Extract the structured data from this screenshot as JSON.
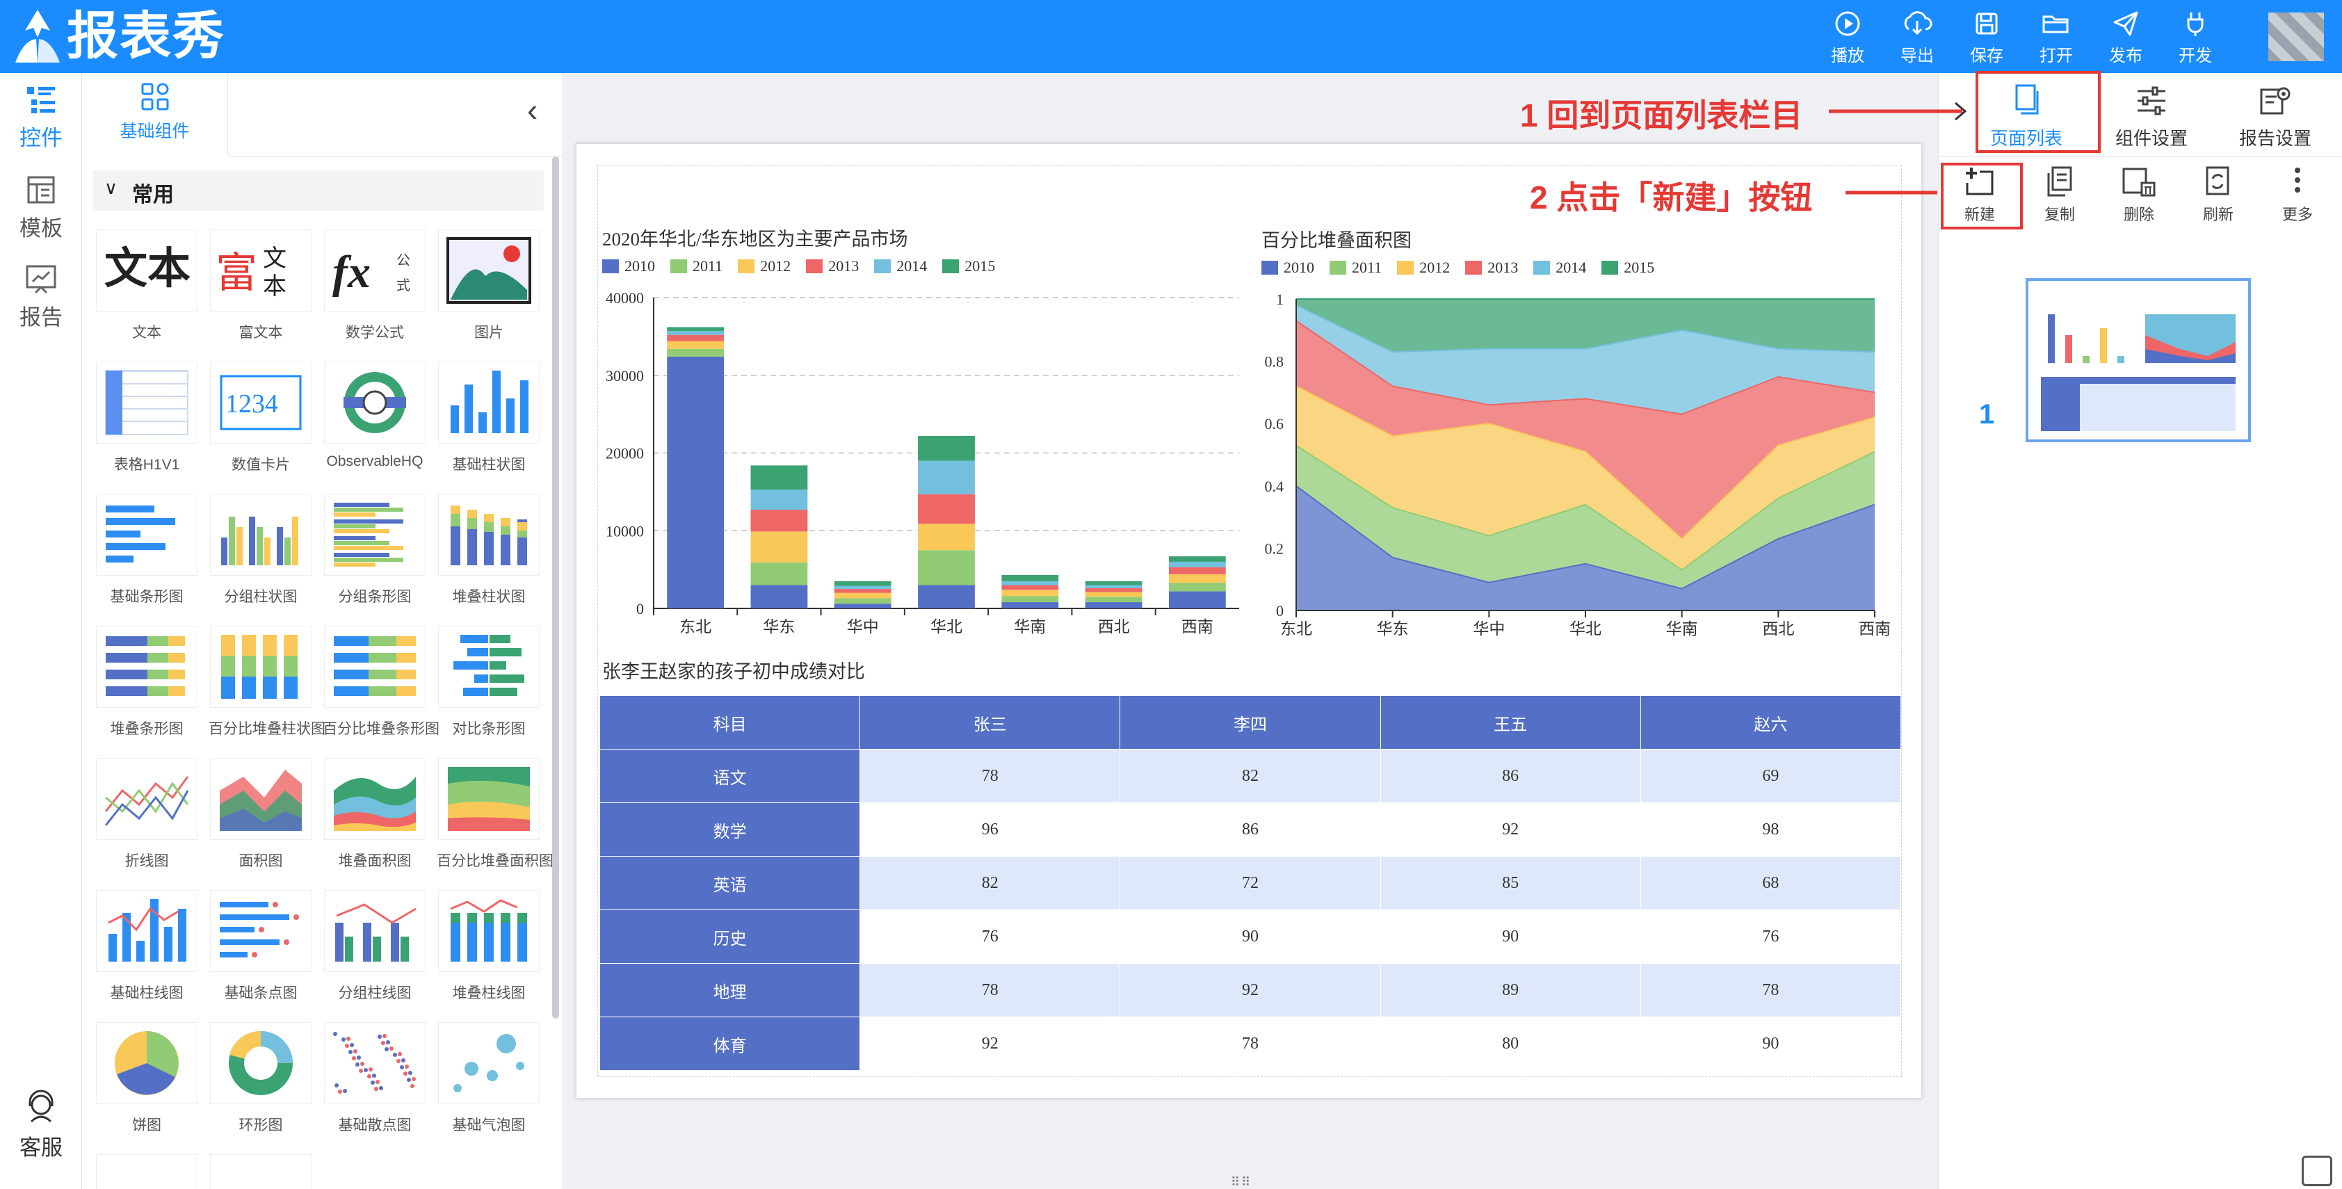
{
  "app": {
    "title": "报表秀"
  },
  "toolbar": {
    "items": [
      {
        "label": "播放",
        "icon": "play-icon"
      },
      {
        "label": "导出",
        "icon": "download-icon"
      },
      {
        "label": "保存",
        "icon": "save-icon"
      },
      {
        "label": "打开",
        "icon": "folder-icon"
      },
      {
        "label": "发布",
        "icon": "send-icon"
      },
      {
        "label": "开发",
        "icon": "plug-icon"
      }
    ]
  },
  "leftnav": {
    "items": [
      {
        "label": "控件",
        "icon": "widgets-icon",
        "active": true
      },
      {
        "label": "模板",
        "icon": "template-icon"
      },
      {
        "label": "报告",
        "icon": "report-icon"
      }
    ],
    "support": "客服"
  },
  "panel": {
    "tab": "基础组件",
    "section": "常用",
    "widgets": [
      {
        "label": "文本",
        "icon": "text-widget-icon"
      },
      {
        "label": "富文本",
        "icon": "rich-text-icon"
      },
      {
        "label": "数学公式",
        "icon": "formula-icon"
      },
      {
        "label": "图片",
        "icon": "image-icon"
      },
      {
        "label": "表格H1V1",
        "icon": "table-icon"
      },
      {
        "label": "数值卡片",
        "icon": "number-card-icon"
      },
      {
        "label": "ObservableHQ",
        "icon": "observable-icon"
      },
      {
        "label": "基础柱状图",
        "icon": "bar-chart-icon"
      },
      {
        "label": "基础条形图",
        "icon": "hbar-chart-icon"
      },
      {
        "label": "分组柱状图",
        "icon": "grouped-bar-icon"
      },
      {
        "label": "分组条形图",
        "icon": "grouped-hbar-icon"
      },
      {
        "label": "堆叠柱状图",
        "icon": "stacked-bar-icon"
      },
      {
        "label": "堆叠条形图",
        "icon": "stacked-hbar-icon"
      },
      {
        "label": "百分比堆叠柱状图",
        "icon": "percent-stacked-bar-icon"
      },
      {
        "label": "百分比堆叠条形图",
        "icon": "percent-stacked-hbar-icon"
      },
      {
        "label": "对比条形图",
        "icon": "compare-hbar-icon"
      },
      {
        "label": "折线图",
        "icon": "line-chart-icon"
      },
      {
        "label": "面积图",
        "icon": "area-chart-icon"
      },
      {
        "label": "堆叠面积图",
        "icon": "stacked-area-icon"
      },
      {
        "label": "百分比堆叠面积图",
        "icon": "percent-area-icon"
      },
      {
        "label": "基础柱线图",
        "icon": "bar-line-icon"
      },
      {
        "label": "基础条点图",
        "icon": "bar-dot-icon"
      },
      {
        "label": "分组柱线图",
        "icon": "grouped-bar-line-icon"
      },
      {
        "label": "堆叠柱线图",
        "icon": "stacked-bar-line-icon"
      },
      {
        "label": "饼图",
        "icon": "pie-icon"
      },
      {
        "label": "环形图",
        "icon": "donut-icon"
      },
      {
        "label": "基础散点图",
        "icon": "scatter-icon"
      },
      {
        "label": "基础气泡图",
        "icon": "bubble-icon"
      }
    ]
  },
  "rightpanel": {
    "tabs": [
      {
        "label": "页面列表",
        "icon": "pages-icon",
        "active": true
      },
      {
        "label": "组件设置",
        "icon": "sliders-icon"
      },
      {
        "label": "报告设置",
        "icon": "report-settings-icon"
      }
    ],
    "tools": [
      {
        "label": "新建",
        "icon": "new-page-icon"
      },
      {
        "label": "复制",
        "icon": "copy-icon"
      },
      {
        "label": "删除",
        "icon": "delete-icon"
      },
      {
        "label": "刷新",
        "icon": "refresh-icon"
      },
      {
        "label": "更多",
        "icon": "more-icon"
      }
    ],
    "page_number": "1"
  },
  "callouts": {
    "one": "1 回到页面列表栏目",
    "two": "2 点击「新建」按钮"
  },
  "colors": {
    "brand": "#1a8cff",
    "series": [
      "#5470c6",
      "#91cc75",
      "#fac858",
      "#ee6666",
      "#73c0de",
      "#3ba272"
    ],
    "highlight": "#e53935"
  },
  "chart_data": [
    {
      "type": "bar",
      "stacked": true,
      "title": "2020年华北/华东地区为主要产品市场",
      "categories": [
        "东北",
        "华东",
        "华中",
        "华北",
        "华南",
        "西北",
        "西南"
      ],
      "yticks": [
        "0",
        "10000",
        "20000",
        "30000",
        "40000"
      ],
      "ylim": [
        0,
        40000
      ],
      "grid": true,
      "legend": "top-left",
      "series": [
        {
          "name": "2010",
          "values": [
            32400,
            3000,
            600,
            3000,
            800,
            800,
            2200
          ]
        },
        {
          "name": "2011",
          "values": [
            1000,
            2900,
            700,
            4500,
            800,
            700,
            1100
          ]
        },
        {
          "name": "2012",
          "values": [
            1000,
            4000,
            700,
            3400,
            800,
            600,
            1100
          ]
        },
        {
          "name": "2013",
          "values": [
            800,
            2800,
            500,
            3800,
            600,
            500,
            900
          ]
        },
        {
          "name": "2014",
          "values": [
            500,
            2600,
            400,
            4300,
            500,
            400,
            700
          ]
        },
        {
          "name": "2015",
          "values": [
            500,
            3100,
            600,
            3200,
            800,
            500,
            700
          ]
        }
      ]
    },
    {
      "type": "area",
      "stacked": "percent",
      "title": "百分比堆叠面积图",
      "categories": [
        "东北",
        "华东",
        "华中",
        "华北",
        "华南",
        "西北",
        "西南"
      ],
      "yticks": [
        "0",
        "0.2",
        "0.4",
        "0.6",
        "0.8",
        "1"
      ],
      "ylim": [
        0,
        1
      ],
      "legend": "top-left",
      "series": [
        {
          "name": "2010",
          "values": [
            0.4,
            0.17,
            0.09,
            0.15,
            0.07,
            0.23,
            0.34
          ]
        },
        {
          "name": "2011",
          "values": [
            0.13,
            0.16,
            0.15,
            0.19,
            0.06,
            0.13,
            0.17
          ]
        },
        {
          "name": "2012",
          "values": [
            0.19,
            0.23,
            0.36,
            0.17,
            0.1,
            0.17,
            0.11
          ]
        },
        {
          "name": "2013",
          "values": [
            0.21,
            0.16,
            0.06,
            0.17,
            0.4,
            0.22,
            0.08
          ]
        },
        {
          "name": "2014",
          "values": [
            0.05,
            0.11,
            0.18,
            0.16,
            0.27,
            0.09,
            0.13
          ]
        },
        {
          "name": "2015",
          "values": [
            0.02,
            0.17,
            0.16,
            0.16,
            0.1,
            0.16,
            0.17
          ]
        }
      ]
    },
    {
      "type": "table",
      "title": "张李王赵家的孩子初中成绩对比",
      "header": [
        "科目",
        "张三",
        "李四",
        "王五",
        "赵六"
      ],
      "rows": [
        [
          "语文",
          "78",
          "82",
          "86",
          "69"
        ],
        [
          "数学",
          "96",
          "86",
          "92",
          "98"
        ],
        [
          "英语",
          "82",
          "72",
          "85",
          "68"
        ],
        [
          "历史",
          "76",
          "90",
          "90",
          "76"
        ],
        [
          "地理",
          "78",
          "92",
          "89",
          "78"
        ],
        [
          "体育",
          "92",
          "78",
          "80",
          "90"
        ]
      ]
    }
  ]
}
